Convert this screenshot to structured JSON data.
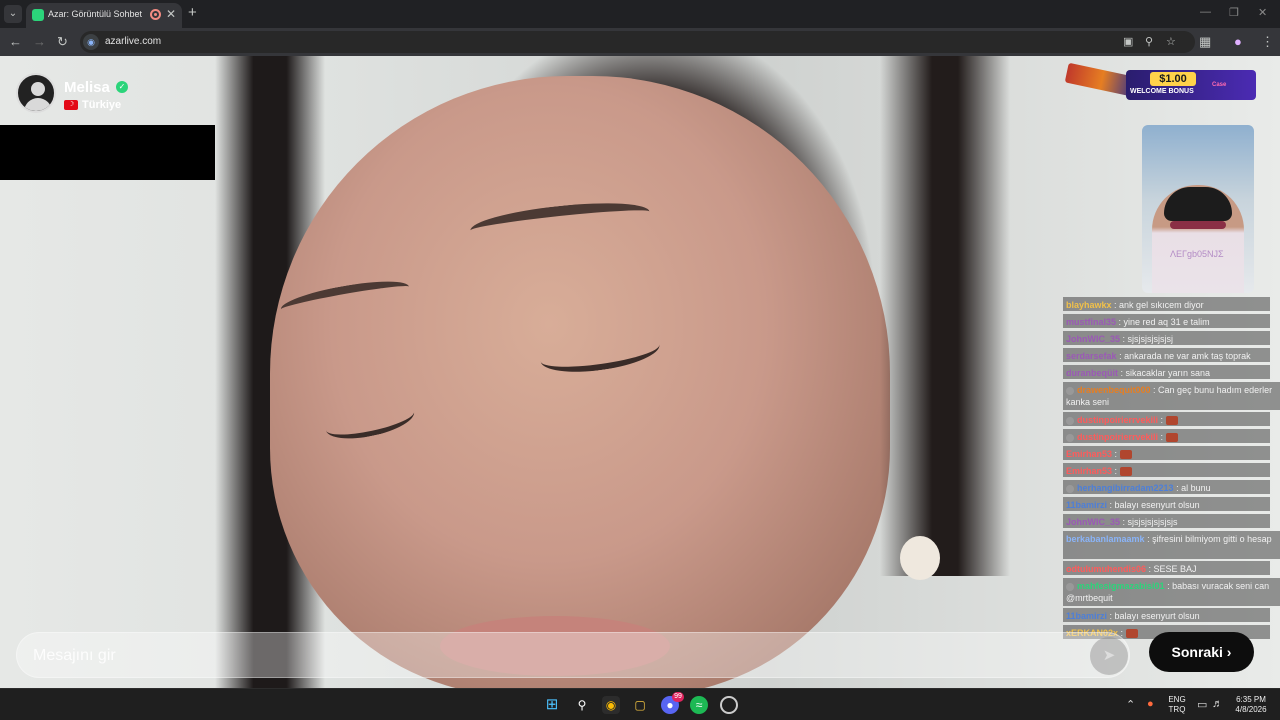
{
  "browser": {
    "tab_title": "Azar: Görüntülü Sohbet & ",
    "url": "azarlive.com"
  },
  "profile": {
    "name": "Melisa",
    "country": "Türkiye"
  },
  "ad": {
    "amount": "$1.00",
    "text": "WELCOME BONUS",
    "brand": "Case"
  },
  "self_cam": {
    "tag": "ΛΕΓgb05NJΣ"
  },
  "chat": {
    "messages": [
      {
        "user": "blayhawkx",
        "text": ": ank gel sıkıcem diyor",
        "color": "#f0c04a"
      },
      {
        "user": "mustfinal35",
        "text": ": yine red aq 31 e talim",
        "color": "#9b59b6"
      },
      {
        "user": "JohnWIC_35",
        "text": ": sjsjsjsjsjsjsj",
        "color": "#9b59b6"
      },
      {
        "user": "serdarsefak",
        "text": ": ankarada ne var amk taş toprak",
        "color": "#9b59b6"
      },
      {
        "user": "duranbeqüit",
        "text": ": sikacaklar yarın sana",
        "color": "#9b59b6"
      },
      {
        "user": "drawenbequit000",
        "text": ": Can geç bunu hadım ederler kanka seni",
        "color": "#e67e22"
      },
      {
        "user": "dustinpoirierrvekili",
        "text": ":",
        "color": "#ff5b5b"
      },
      {
        "user": "dustinpoirierrvekili",
        "text": ":",
        "color": "#ff5b5b"
      },
      {
        "user": "Emirhan53",
        "text": ":",
        "color": "#ff5b5b"
      },
      {
        "user": "Emirhan53",
        "text": ":",
        "color": "#ff5b5b"
      },
      {
        "user": "herhangibirradam2213",
        "text": ": al bunu",
        "color": "#4d7fd8"
      },
      {
        "user": "11bamirzi",
        "text": ": balayı esenyurt olsun",
        "color": "#4d7fd8"
      },
      {
        "user": "JohnWIC_35",
        "text": ": sjsjsjsjsjsjsjs",
        "color": "#9b59b6"
      },
      {
        "user": "berkabanlamaamk",
        "text": ": şifresini bilmiyom gitti o hesap",
        "color": "#8ab4f8"
      },
      {
        "user": "odtulumuhendis06",
        "text": ": SESE BAJ",
        "color": "#ff5b5b"
      },
      {
        "user": "mahfesigmazabisi01",
        "text": ": babası vuracak seni can @mrtbequit",
        "color": "#2bd47a"
      },
      {
        "user": "11bamirzi",
        "text": ": balayı esenyurt olsun",
        "color": "#4d7fd8"
      },
      {
        "user": "xERKAN02x",
        "text": ":",
        "color": "#f0c04a"
      }
    ]
  },
  "message": {
    "placeholder": "Mesajını gir"
  },
  "next_button": {
    "label": "Sonraki"
  },
  "tray": {
    "lang_top": "ENG",
    "lang_bottom": "TRQ",
    "time": "6:35 PM",
    "date": "4/8/2026"
  },
  "taskbar": {
    "discord_badge": "99"
  }
}
